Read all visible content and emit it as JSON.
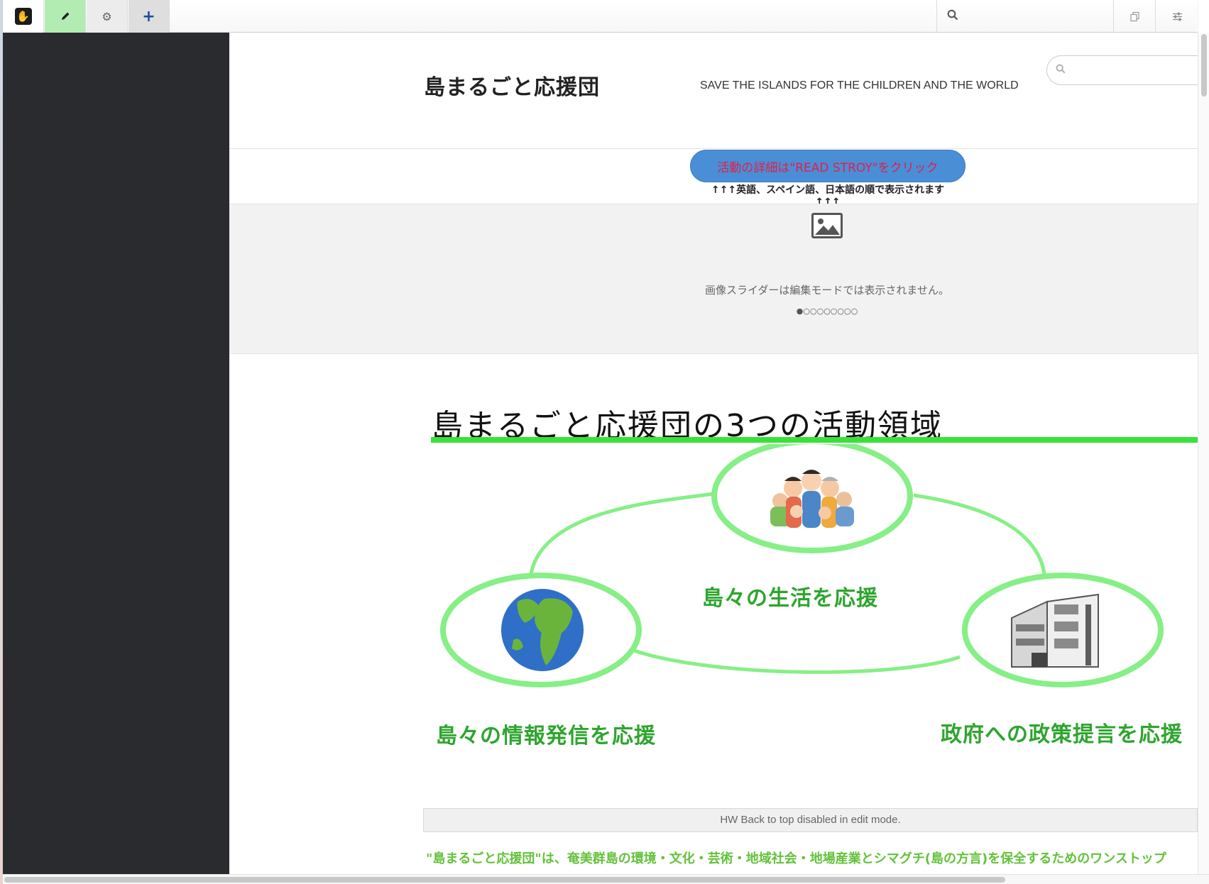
{
  "toolbar": {
    "logo_icon": "concrete-hand-logo-icon",
    "edit_icon": "pencil-icon",
    "settings_icon": "gear-icon",
    "add_icon": "plus-icon",
    "search_icon": "search-icon",
    "search_placeholder": "",
    "right_icons": [
      "copy-pages-icon",
      "sliders-icon"
    ],
    "edit_active_color": "#b3ecb3"
  },
  "header": {
    "site_title": "島まるごと応援団",
    "tagline": "SAVE THE ISLANDS FOR THE CHILDREN AND THE WORLD",
    "search_placeholder": ""
  },
  "cta": {
    "button_label": "活動の詳細は\"READ STROY\"をクリック",
    "note": "↑↑↑英語、スペイン語、日本語の順で表示されます↑↑↑",
    "button_color": "#4a8ed6",
    "button_text_color": "#e0204a"
  },
  "slider": {
    "placeholder_icon": "image-icon",
    "message": "画像スライダーは編集モードでは表示されません。",
    "dots": "●○○○○○○○○"
  },
  "activities": {
    "heading": "島まるごと応援団の3つの活動領域",
    "accent_color": "#38e238",
    "items": [
      {
        "label": "島々の生活を応援",
        "icon": "people-group-icon"
      },
      {
        "label": "島々の情報発信を応援",
        "icon": "globe-icon"
      },
      {
        "label": "政府への政策提言を応援",
        "icon": "building-icon"
      }
    ]
  },
  "back_to_top": {
    "text": "HW Back to top disabled in edit mode."
  },
  "footer": {
    "text": "\"島まるごと応援団\"は、奄美群島の環境・文化・芸術・地域社会・地場産業とシマグチ(島の方言)を保全するためのワンストップ"
  }
}
